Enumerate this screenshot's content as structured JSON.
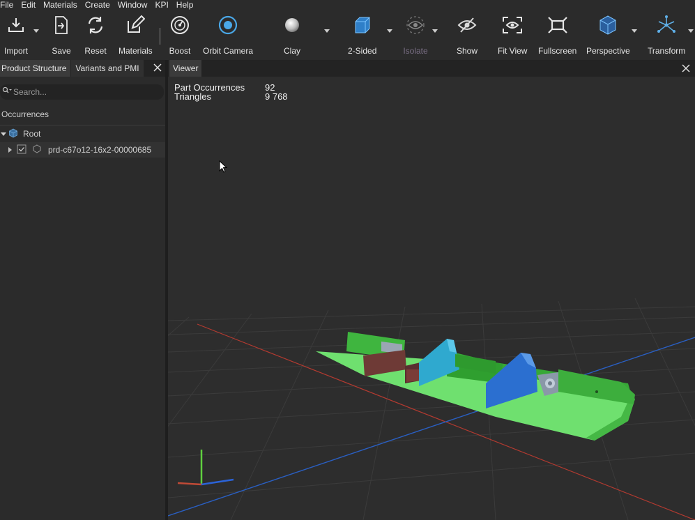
{
  "menu": [
    "File",
    "Edit",
    "Materials",
    "Create",
    "Window",
    "KPI",
    "Help"
  ],
  "toolbar": {
    "import": "Import",
    "save": "Save",
    "reset": "Reset",
    "materials": "Materials",
    "boost": "Boost",
    "orbit_camera": "Orbit Camera",
    "clay": "Clay",
    "two_sided": "2-Sided",
    "isolate": "Isolate",
    "show": "Show",
    "fit_view": "Fit View",
    "fullscreen": "Fullscreen",
    "perspective": "Perspective",
    "transform": "Transform"
  },
  "left_panel": {
    "tabs": [
      "Product Structure",
      "Variants and PMI"
    ],
    "search_placeholder": "Search...",
    "section_title": "Occurrences",
    "tree": {
      "root": "Root",
      "child": "prd-c67o12-16x2-00000685"
    }
  },
  "viewer": {
    "tab": "Viewer",
    "stats": {
      "part_occurrences_label": "Part Occurrences",
      "part_occurrences_value": "92",
      "triangles_label": "Triangles",
      "triangles_value": "9 768"
    }
  },
  "colors": {
    "accent_blue": "#4aa8e8",
    "part_green": "#5fcf5f",
    "part_blue": "#2b6fd0",
    "part_cyan": "#2fb0d8",
    "axis_red": "#c0392b",
    "axis_blue": "#2b63c8"
  },
  "icons": [
    "download-icon",
    "save-icon",
    "reset-icon",
    "edit-icon",
    "boost-gauge-icon",
    "orbit-icon",
    "sphere-icon",
    "cube-icon",
    "eye-icon",
    "eye-slash-icon",
    "fit-view-icon",
    "fullscreen-icon",
    "perspective-icon",
    "transform-icon"
  ]
}
